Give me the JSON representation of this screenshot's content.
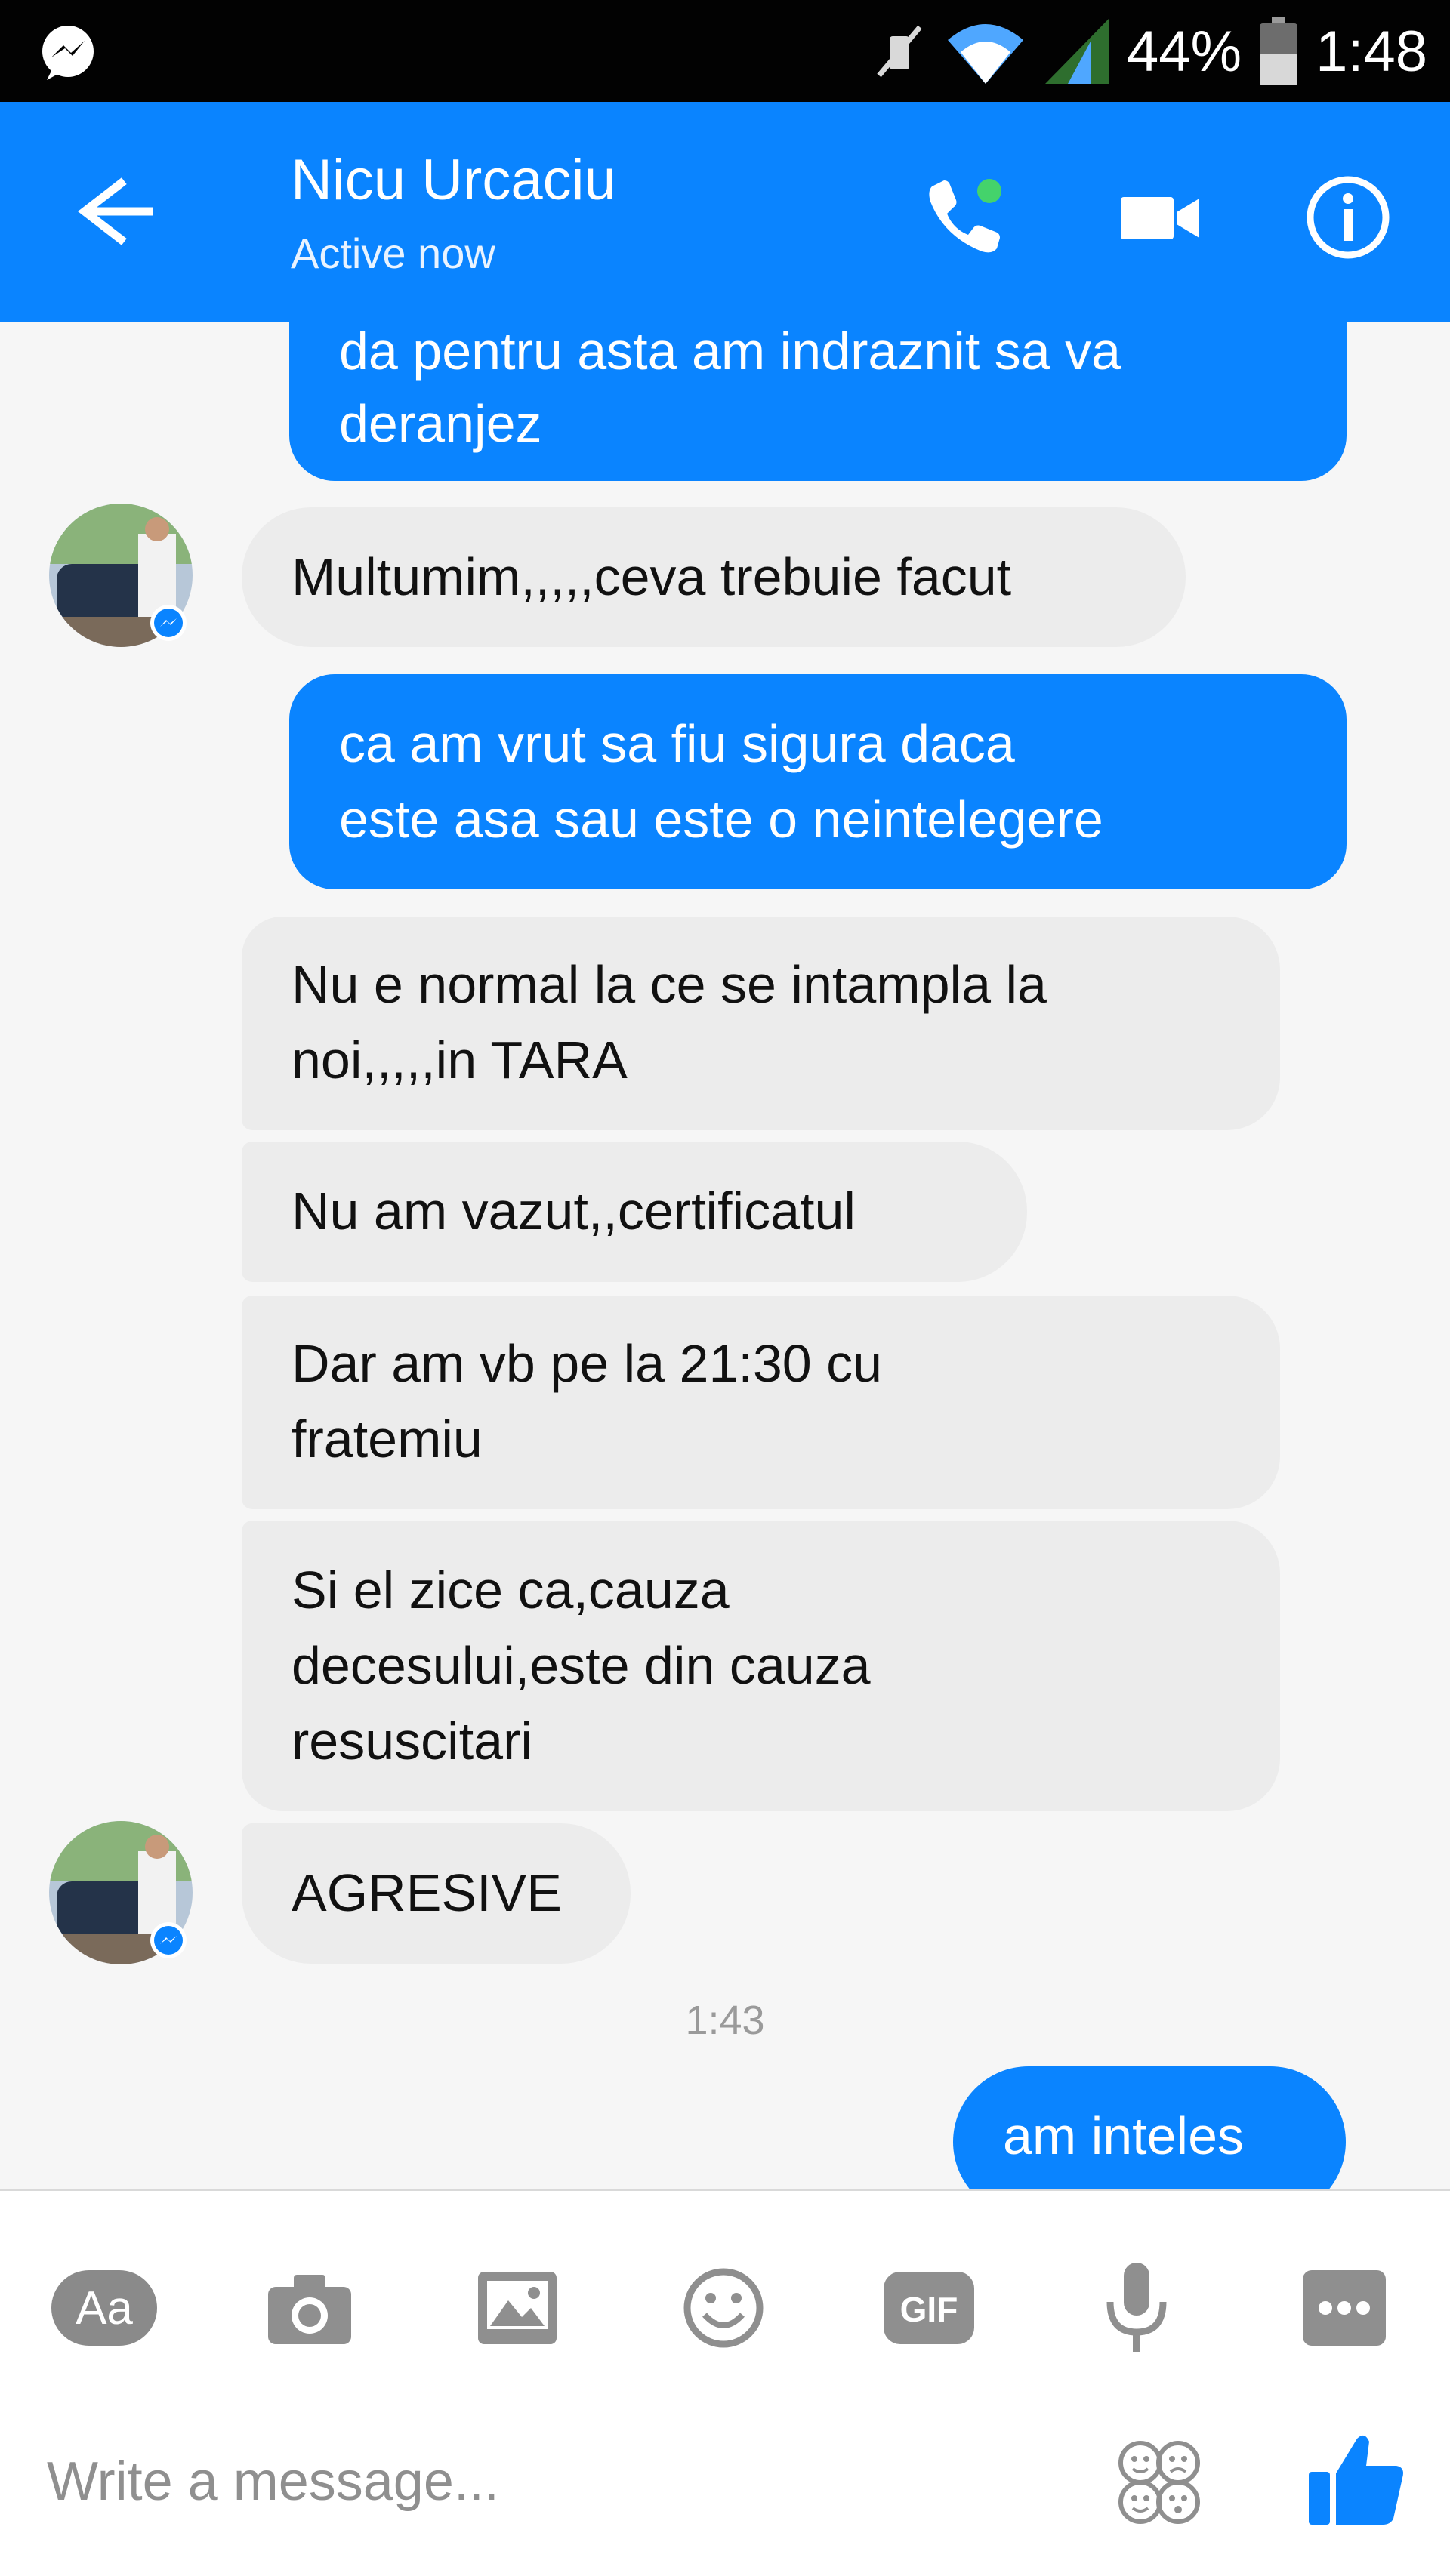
{
  "status_bar": {
    "battery_percent_text": "44%",
    "time": "1:48",
    "icons": [
      "messenger-icon",
      "mute-icon",
      "wifi-icon",
      "signal-icon",
      "battery-icon"
    ]
  },
  "header": {
    "name": "Nicu Urcaciu",
    "status": "Active now",
    "icons": [
      "back-arrow-icon",
      "phone-icon",
      "video-camera-icon",
      "info-icon"
    ]
  },
  "messages": [
    {
      "direction": "outgoing",
      "text": "da pentru asta am indraznit sa va\nderanjez"
    },
    {
      "direction": "incoming",
      "text": "Multumim,,,,,ceva trebuie facut"
    },
    {
      "direction": "outgoing",
      "text": "ca am vrut sa fiu sigura daca\neste asa sau este o neintelegere"
    },
    {
      "direction": "incoming",
      "text": "Nu e normal la ce se intampla la\nnoi,,,,,in TARA"
    },
    {
      "direction": "incoming",
      "text": "Nu am vazut,,certificatul"
    },
    {
      "direction": "incoming",
      "text": "Dar am vb pe la 21:30 cu\nfratemiu"
    },
    {
      "direction": "incoming",
      "text": "Si el zice ca,cauza\ndecesului,este din cauza\nresuscitari"
    },
    {
      "direction": "incoming",
      "text": "AGRESIVE"
    },
    {
      "direction": "outgoing",
      "text": "am inteles"
    }
  ],
  "timestamp": "1:43",
  "composer": {
    "aa_label": "Aa",
    "gif_label": "GIF",
    "placeholder": "Write a message...",
    "tools": [
      "text-style-button",
      "camera-icon",
      "gallery-icon",
      "emoji-icon",
      "gif-icon",
      "microphone-icon",
      "more-icon"
    ]
  },
  "colors": {
    "brand_blue": "#0a84ff",
    "incoming_bubble": "#ececec",
    "status_bar": "#020202",
    "online_dot": "#44d36b"
  }
}
